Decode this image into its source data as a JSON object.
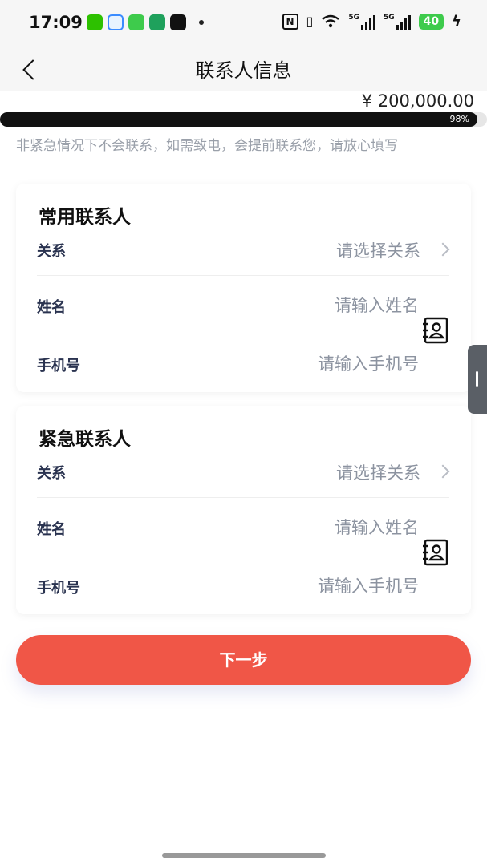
{
  "status_bar": {
    "time": "17:09",
    "network_1": "5G",
    "network_2": "5G",
    "battery": "40"
  },
  "header": {
    "title": "联系人信息"
  },
  "progress": {
    "amount": "¥ 200,000.00",
    "percent_label": "98%",
    "fraction": 0.98
  },
  "notice": "非紧急情况下不会联系，如需致电，会提前联系您，请放心填写",
  "cards": [
    {
      "title": "常用联系人",
      "relation_label": "关系",
      "relation_placeholder": "请选择关系",
      "name_label": "姓名",
      "name_placeholder": "请输入姓名",
      "phone_label": "手机号",
      "phone_placeholder": "请输入手机号"
    },
    {
      "title": "紧急联系人",
      "relation_label": "关系",
      "relation_placeholder": "请选择关系",
      "name_label": "姓名",
      "name_placeholder": "请输入姓名",
      "phone_label": "手机号",
      "phone_placeholder": "请输入手机号"
    }
  ],
  "submit_label": "下一步",
  "colors": {
    "primary": "#f05647",
    "background": "#f6f6f6",
    "label": "#2a3350",
    "placeholder": "#8c93a0"
  }
}
